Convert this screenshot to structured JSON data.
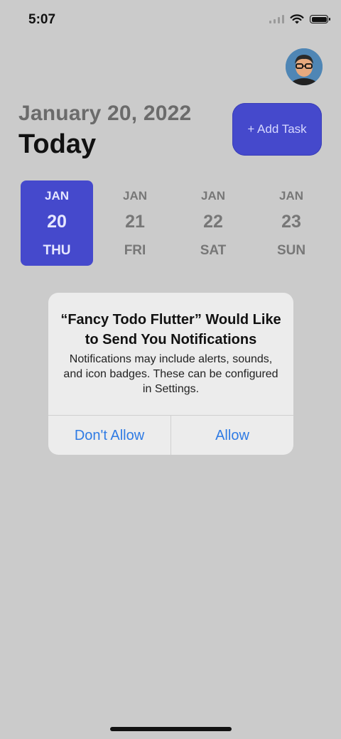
{
  "status_bar": {
    "time": "5:07"
  },
  "header": {
    "date": "January 20, 2022",
    "today": "Today",
    "add_task_label": "+ Add Task"
  },
  "days": [
    {
      "month": "JAN",
      "day": "20",
      "weekday": "THU",
      "selected": true
    },
    {
      "month": "JAN",
      "day": "21",
      "weekday": "FRI",
      "selected": false
    },
    {
      "month": "JAN",
      "day": "22",
      "weekday": "SAT",
      "selected": false
    },
    {
      "month": "JAN",
      "day": "23",
      "weekday": "SUN",
      "selected": false
    }
  ],
  "alert": {
    "title": "“Fancy Todo Flutter” Would Like to Send You Notifications",
    "message": "Notifications may include alerts, sounds, and icon badges. These can be configured in Settings.",
    "deny_label": "Don't Allow",
    "allow_label": "Allow"
  },
  "colors": {
    "background": "#cbcbcb",
    "accent": "#4549cc",
    "alert_button": "#2f7be4"
  }
}
